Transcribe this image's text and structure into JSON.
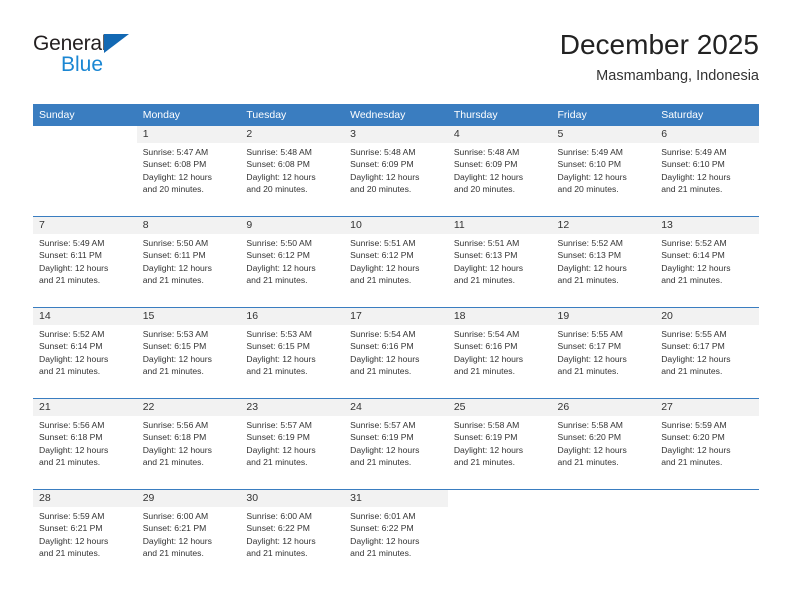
{
  "brand": {
    "name_part1": "General",
    "name_part2": "Blue",
    "triangle_icon": "triangle-icon",
    "accent_dark": "#231f20",
    "accent_blue": "#1b87d3",
    "triangle_blue": "#1268b3"
  },
  "header": {
    "title": "December 2025",
    "subtitle": "Masmambang, Indonesia",
    "header_bg": "#3a7dc0",
    "header_text": "#ffffff"
  },
  "weekday_headers": [
    "Sunday",
    "Monday",
    "Tuesday",
    "Wednesday",
    "Thursday",
    "Friday",
    "Saturday"
  ],
  "weeks": [
    [
      {
        "day": "",
        "sunrise": "",
        "sunset": "",
        "daylight_line1": "",
        "daylight_line2": ""
      },
      {
        "day": "1",
        "sunrise": "Sunrise: 5:47 AM",
        "sunset": "Sunset: 6:08 PM",
        "daylight_line1": "Daylight: 12 hours",
        "daylight_line2": "and 20 minutes."
      },
      {
        "day": "2",
        "sunrise": "Sunrise: 5:48 AM",
        "sunset": "Sunset: 6:08 PM",
        "daylight_line1": "Daylight: 12 hours",
        "daylight_line2": "and 20 minutes."
      },
      {
        "day": "3",
        "sunrise": "Sunrise: 5:48 AM",
        "sunset": "Sunset: 6:09 PM",
        "daylight_line1": "Daylight: 12 hours",
        "daylight_line2": "and 20 minutes."
      },
      {
        "day": "4",
        "sunrise": "Sunrise: 5:48 AM",
        "sunset": "Sunset: 6:09 PM",
        "daylight_line1": "Daylight: 12 hours",
        "daylight_line2": "and 20 minutes."
      },
      {
        "day": "5",
        "sunrise": "Sunrise: 5:49 AM",
        "sunset": "Sunset: 6:10 PM",
        "daylight_line1": "Daylight: 12 hours",
        "daylight_line2": "and 20 minutes."
      },
      {
        "day": "6",
        "sunrise": "Sunrise: 5:49 AM",
        "sunset": "Sunset: 6:10 PM",
        "daylight_line1": "Daylight: 12 hours",
        "daylight_line2": "and 21 minutes."
      }
    ],
    [
      {
        "day": "7",
        "sunrise": "Sunrise: 5:49 AM",
        "sunset": "Sunset: 6:11 PM",
        "daylight_line1": "Daylight: 12 hours",
        "daylight_line2": "and 21 minutes."
      },
      {
        "day": "8",
        "sunrise": "Sunrise: 5:50 AM",
        "sunset": "Sunset: 6:11 PM",
        "daylight_line1": "Daylight: 12 hours",
        "daylight_line2": "and 21 minutes."
      },
      {
        "day": "9",
        "sunrise": "Sunrise: 5:50 AM",
        "sunset": "Sunset: 6:12 PM",
        "daylight_line1": "Daylight: 12 hours",
        "daylight_line2": "and 21 minutes."
      },
      {
        "day": "10",
        "sunrise": "Sunrise: 5:51 AM",
        "sunset": "Sunset: 6:12 PM",
        "daylight_line1": "Daylight: 12 hours",
        "daylight_line2": "and 21 minutes."
      },
      {
        "day": "11",
        "sunrise": "Sunrise: 5:51 AM",
        "sunset": "Sunset: 6:13 PM",
        "daylight_line1": "Daylight: 12 hours",
        "daylight_line2": "and 21 minutes."
      },
      {
        "day": "12",
        "sunrise": "Sunrise: 5:52 AM",
        "sunset": "Sunset: 6:13 PM",
        "daylight_line1": "Daylight: 12 hours",
        "daylight_line2": "and 21 minutes."
      },
      {
        "day": "13",
        "sunrise": "Sunrise: 5:52 AM",
        "sunset": "Sunset: 6:14 PM",
        "daylight_line1": "Daylight: 12 hours",
        "daylight_line2": "and 21 minutes."
      }
    ],
    [
      {
        "day": "14",
        "sunrise": "Sunrise: 5:52 AM",
        "sunset": "Sunset: 6:14 PM",
        "daylight_line1": "Daylight: 12 hours",
        "daylight_line2": "and 21 minutes."
      },
      {
        "day": "15",
        "sunrise": "Sunrise: 5:53 AM",
        "sunset": "Sunset: 6:15 PM",
        "daylight_line1": "Daylight: 12 hours",
        "daylight_line2": "and 21 minutes."
      },
      {
        "day": "16",
        "sunrise": "Sunrise: 5:53 AM",
        "sunset": "Sunset: 6:15 PM",
        "daylight_line1": "Daylight: 12 hours",
        "daylight_line2": "and 21 minutes."
      },
      {
        "day": "17",
        "sunrise": "Sunrise: 5:54 AM",
        "sunset": "Sunset: 6:16 PM",
        "daylight_line1": "Daylight: 12 hours",
        "daylight_line2": "and 21 minutes."
      },
      {
        "day": "18",
        "sunrise": "Sunrise: 5:54 AM",
        "sunset": "Sunset: 6:16 PM",
        "daylight_line1": "Daylight: 12 hours",
        "daylight_line2": "and 21 minutes."
      },
      {
        "day": "19",
        "sunrise": "Sunrise: 5:55 AM",
        "sunset": "Sunset: 6:17 PM",
        "daylight_line1": "Daylight: 12 hours",
        "daylight_line2": "and 21 minutes."
      },
      {
        "day": "20",
        "sunrise": "Sunrise: 5:55 AM",
        "sunset": "Sunset: 6:17 PM",
        "daylight_line1": "Daylight: 12 hours",
        "daylight_line2": "and 21 minutes."
      }
    ],
    [
      {
        "day": "21",
        "sunrise": "Sunrise: 5:56 AM",
        "sunset": "Sunset: 6:18 PM",
        "daylight_line1": "Daylight: 12 hours",
        "daylight_line2": "and 21 minutes."
      },
      {
        "day": "22",
        "sunrise": "Sunrise: 5:56 AM",
        "sunset": "Sunset: 6:18 PM",
        "daylight_line1": "Daylight: 12 hours",
        "daylight_line2": "and 21 minutes."
      },
      {
        "day": "23",
        "sunrise": "Sunrise: 5:57 AM",
        "sunset": "Sunset: 6:19 PM",
        "daylight_line1": "Daylight: 12 hours",
        "daylight_line2": "and 21 minutes."
      },
      {
        "day": "24",
        "sunrise": "Sunrise: 5:57 AM",
        "sunset": "Sunset: 6:19 PM",
        "daylight_line1": "Daylight: 12 hours",
        "daylight_line2": "and 21 minutes."
      },
      {
        "day": "25",
        "sunrise": "Sunrise: 5:58 AM",
        "sunset": "Sunset: 6:19 PM",
        "daylight_line1": "Daylight: 12 hours",
        "daylight_line2": "and 21 minutes."
      },
      {
        "day": "26",
        "sunrise": "Sunrise: 5:58 AM",
        "sunset": "Sunset: 6:20 PM",
        "daylight_line1": "Daylight: 12 hours",
        "daylight_line2": "and 21 minutes."
      },
      {
        "day": "27",
        "sunrise": "Sunrise: 5:59 AM",
        "sunset": "Sunset: 6:20 PM",
        "daylight_line1": "Daylight: 12 hours",
        "daylight_line2": "and 21 minutes."
      }
    ],
    [
      {
        "day": "28",
        "sunrise": "Sunrise: 5:59 AM",
        "sunset": "Sunset: 6:21 PM",
        "daylight_line1": "Daylight: 12 hours",
        "daylight_line2": "and 21 minutes."
      },
      {
        "day": "29",
        "sunrise": "Sunrise: 6:00 AM",
        "sunset": "Sunset: 6:21 PM",
        "daylight_line1": "Daylight: 12 hours",
        "daylight_line2": "and 21 minutes."
      },
      {
        "day": "30",
        "sunrise": "Sunrise: 6:00 AM",
        "sunset": "Sunset: 6:22 PM",
        "daylight_line1": "Daylight: 12 hours",
        "daylight_line2": "and 21 minutes."
      },
      {
        "day": "31",
        "sunrise": "Sunrise: 6:01 AM",
        "sunset": "Sunset: 6:22 PM",
        "daylight_line1": "Daylight: 12 hours",
        "daylight_line2": "and 21 minutes."
      },
      {
        "day": "",
        "sunrise": "",
        "sunset": "",
        "daylight_line1": "",
        "daylight_line2": ""
      },
      {
        "day": "",
        "sunrise": "",
        "sunset": "",
        "daylight_line1": "",
        "daylight_line2": ""
      },
      {
        "day": "",
        "sunrise": "",
        "sunset": "",
        "daylight_line1": "",
        "daylight_line2": ""
      }
    ]
  ]
}
